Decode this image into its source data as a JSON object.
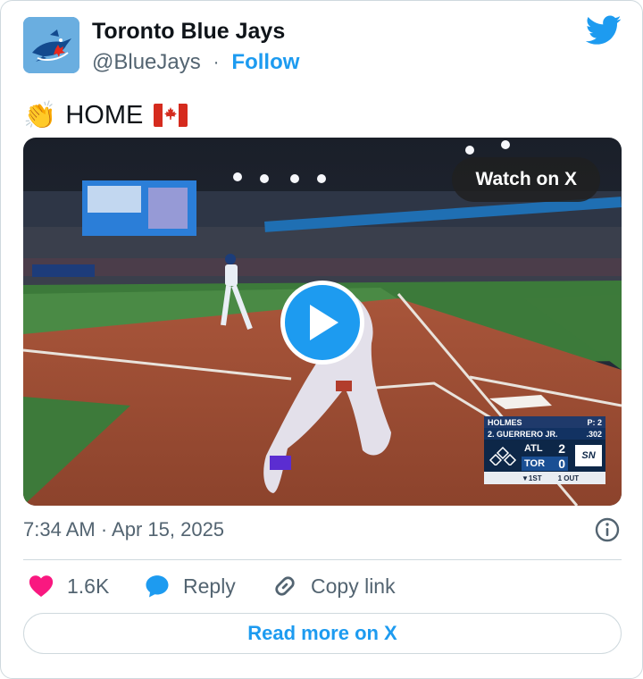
{
  "author": {
    "name": "Toronto Blue Jays",
    "handle": "@BlueJays",
    "separator": "·",
    "follow_label": "Follow"
  },
  "tweet": {
    "emoji": "👏",
    "text": "HOME"
  },
  "media": {
    "watch_label": "Watch on X",
    "scorebug": {
      "pitcher": "HOLMES",
      "pitch_count": "P: 2",
      "batter": "2. GUERRERO JR.",
      "batter_avg": ".302",
      "away_team": "ATL",
      "away_score": "2",
      "home_team": "TOR",
      "home_score": "0",
      "inning": "▼1ST",
      "outs": "1 OUT",
      "network": "SN"
    }
  },
  "timestamp": "7:34 AM · Apr 15, 2025",
  "actions": {
    "likes_count": "1.6K",
    "reply_label": "Reply",
    "copy_label": "Copy link"
  },
  "read_more_label": "Read more on X",
  "colors": {
    "accent": "#1d9bf0",
    "like": "#f91880",
    "text_primary": "#0f1419",
    "text_secondary": "#536471",
    "border": "#cfd9de"
  },
  "icons": {
    "avatar": "blue-jays-logo",
    "brand": "twitter-bird-icon",
    "info": "info-icon",
    "like": "heart-icon",
    "reply": "reply-bubble-icon",
    "copy": "link-icon",
    "play": "play-icon"
  }
}
